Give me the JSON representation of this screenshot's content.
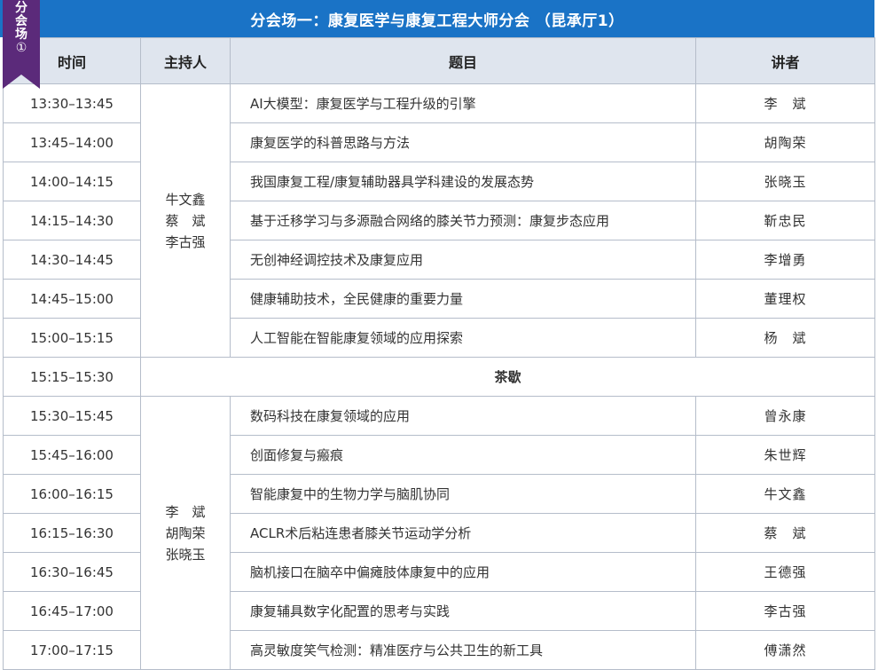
{
  "ribbon": {
    "c1": "分",
    "c2": "会",
    "c3": "场",
    "num": "①"
  },
  "title": "分会场一：康复医学与康复工程大师分会 （昆承厅1）",
  "headers": {
    "time": "时间",
    "host": "主持人",
    "topic": "题目",
    "speaker": "讲者"
  },
  "hosts_1": [
    "牛文鑫",
    "蔡　斌",
    "李古强"
  ],
  "hosts_2": [
    "李　斌",
    "胡陶荣",
    "张晓玉"
  ],
  "rows": [
    {
      "time": "13:30–13:45",
      "topic": "AI大模型：康复医学与工程升级的引擎",
      "speaker": "李　斌"
    },
    {
      "time": "13:45–14:00",
      "topic": "康复医学的科普思路与方法",
      "speaker": "胡陶荣"
    },
    {
      "time": "14:00–14:15",
      "topic": "我国康复工程/康复辅助器具学科建设的发展态势",
      "speaker": "张晓玉"
    },
    {
      "time": "14:15–14:30",
      "topic": "基于迁移学习与多源融合网络的膝关节力预测：康复步态应用",
      "speaker": "靳忠民"
    },
    {
      "time": "14:30–14:45",
      "topic": "无创神经调控技术及康复应用",
      "speaker": "李增勇"
    },
    {
      "time": "14:45–15:00",
      "topic": "健康辅助技术，全民健康的重要力量",
      "speaker": "董理权"
    },
    {
      "time": "15:00–15:15",
      "topic": "人工智能在智能康复领域的应用探索",
      "speaker": "杨　斌"
    }
  ],
  "break_row": {
    "time": "15:15–15:30",
    "label": "茶歇"
  },
  "rows2": [
    {
      "time": "15:30–15:45",
      "topic": "数码科技在康复领域的应用",
      "speaker": "曾永康"
    },
    {
      "time": "15:45–16:00",
      "topic": "创面修复与瘢痕",
      "speaker": "朱世辉"
    },
    {
      "time": "16:00–16:15",
      "topic": "智能康复中的生物力学与脑肌协同",
      "speaker": "牛文鑫"
    },
    {
      "time": "16:15–16:30",
      "topic": "ACLR术后粘连患者膝关节运动学分析",
      "speaker": "蔡　斌"
    },
    {
      "time": "16:30–16:45",
      "topic": "脑机接口在脑卒中偏瘫肢体康复中的应用",
      "speaker": "王德强"
    },
    {
      "time": "16:45–17:00",
      "topic": "康复辅具数字化配置的思考与实践",
      "speaker": "李古强"
    },
    {
      "time": "17:00–17:15",
      "topic": "高灵敏度笑气检测：精准医疗与公共卫生的新工具",
      "speaker": "傅潇然"
    }
  ]
}
